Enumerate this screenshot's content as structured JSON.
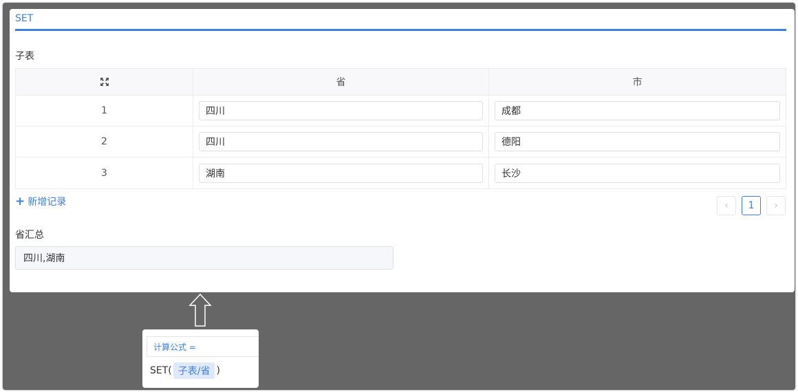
{
  "card": {
    "title": "SET"
  },
  "subtable": {
    "label": "子表",
    "columns": [
      "省",
      "市"
    ],
    "rows": [
      {
        "index": "1",
        "province": "四川",
        "city": "成都"
      },
      {
        "index": "2",
        "province": "四川",
        "city": "德阳"
      },
      {
        "index": "3",
        "province": "湖南",
        "city": "长沙"
      }
    ],
    "add_label": "新增记录",
    "pagination": {
      "prev": "‹",
      "current": "1",
      "next": "›"
    }
  },
  "summary": {
    "label": "省汇总",
    "value": "四川,湖南"
  },
  "formula": {
    "header": "计算公式 =",
    "func": "SET(",
    "field_tag": "子表/省",
    "close": ")"
  },
  "colors": {
    "accent": "#3f7fe0",
    "backdrop": "#666666",
    "tag_bg": "#dfe9fb"
  }
}
